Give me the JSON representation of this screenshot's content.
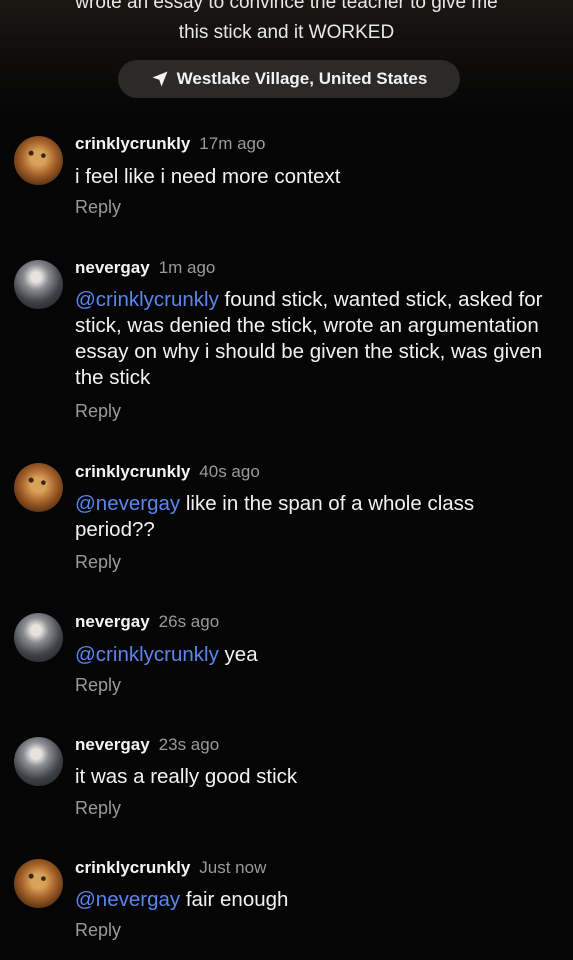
{
  "post": {
    "caption_line1": "wrote an essay to convince the teacher to give me",
    "caption_line2": "this stick and it WORKED",
    "location": "Westlake Village, United States",
    "location_icon": "location-arrow-icon"
  },
  "comments": [
    {
      "username": "crinklycrunkly",
      "time": "17m ago",
      "avatar": "bear-avatar",
      "mention": "",
      "text": "i feel like i need more context",
      "reply": "Reply"
    },
    {
      "username": "nevergay",
      "time": "1m ago",
      "avatar": "cat-avatar",
      "mention": "@crinklycrunkly",
      "text": " found stick, wanted stick, asked for stick, was denied the stick, wrote an argumentation essay on why i should be given the stick, was given the stick",
      "reply": "Reply"
    },
    {
      "username": "crinklycrunkly",
      "time": "40s ago",
      "avatar": "bear-avatar",
      "mention": "@nevergay",
      "text": " like in the span of a whole class period??",
      "reply": "Reply"
    },
    {
      "username": "nevergay",
      "time": "26s ago",
      "avatar": "cat-avatar",
      "mention": "@crinklycrunkly",
      "text": " yea",
      "reply": "Reply"
    },
    {
      "username": "nevergay",
      "time": "23s ago",
      "avatar": "cat-avatar",
      "mention": "",
      "text": "it was a really good stick",
      "reply": "Reply"
    },
    {
      "username": "crinklycrunkly",
      "time": "Just now",
      "avatar": "bear-avatar",
      "mention": "@nevergay",
      "text": " fair enough",
      "reply": "Reply"
    }
  ],
  "colors": {
    "mention": "#5b86ee",
    "background": "#050505",
    "secondary_text": "#9a9a9a"
  }
}
